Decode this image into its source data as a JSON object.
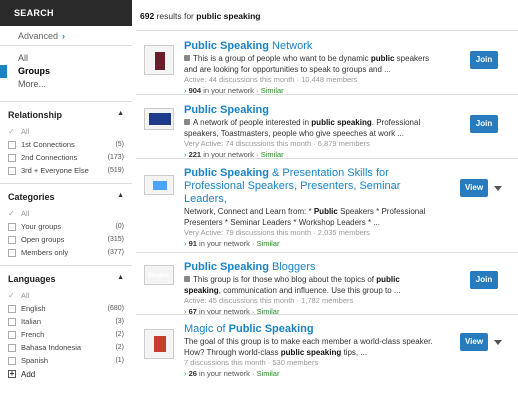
{
  "sidebar": {
    "search_label": "SEARCH",
    "advanced_label": "Advanced",
    "types": [
      {
        "label": "All",
        "active": false
      },
      {
        "label": "Groups",
        "active": true
      },
      {
        "label": "More...",
        "active": false
      }
    ],
    "facets": [
      {
        "title": "Relationship",
        "rows": [
          {
            "label": "All",
            "count": "",
            "checked": true
          },
          {
            "label": "1st Connections",
            "count": "(5)",
            "checked": false
          },
          {
            "label": "2nd Connections",
            "count": "(173)",
            "checked": false
          },
          {
            "label": "3rd + Everyone Else",
            "count": "(519)",
            "checked": false
          }
        ]
      },
      {
        "title": "Categories",
        "rows": [
          {
            "label": "All",
            "count": "",
            "checked": true
          },
          {
            "label": "Your groups",
            "count": "(0)",
            "checked": false
          },
          {
            "label": "Open groups",
            "count": "(315)",
            "checked": false
          },
          {
            "label": "Members only",
            "count": "(377)",
            "checked": false
          }
        ]
      },
      {
        "title": "Languages",
        "rows": [
          {
            "label": "All",
            "count": "",
            "checked": true
          },
          {
            "label": "English",
            "count": "(680)",
            "checked": false
          },
          {
            "label": "Italian",
            "count": "(3)",
            "checked": false
          },
          {
            "label": "French",
            "count": "(2)",
            "checked": false
          },
          {
            "label": "Bahasa Indonesia",
            "count": "(2)",
            "checked": false
          },
          {
            "label": "Spanish",
            "count": "(1)",
            "checked": false
          }
        ],
        "add_label": "Add"
      }
    ]
  },
  "results": {
    "count": "692",
    "results_for": "results for",
    "query": "public speaking",
    "items": [
      {
        "title_bold": "Public Speaking",
        "title_rest": " Network",
        "desc_parts": [
          "This is a group of people who want to be dynamic ",
          "public",
          " speakers and are looking for opportunities to speak to groups and ..."
        ],
        "stats": "Active: 44 discussions this month · 10,448 members",
        "network_count": "904",
        "network_label": "in your network",
        "similar": "Similar",
        "action": "Join",
        "lock": true
      },
      {
        "title_bold": "Public Speaking",
        "title_rest": "",
        "desc_parts": [
          "A network of people interested in ",
          "public speaking",
          ". Professional speakers, Toastmasters, people who give speeches at work ..."
        ],
        "stats": "Very Active: 74 discussions this month · 6,879 members",
        "network_count": "221",
        "network_label": "in your network",
        "similar": "Similar",
        "action": "Join",
        "lock": true
      },
      {
        "title_bold": "Public Speaking",
        "title_rest": " & Presentation Skills for Professional Speakers, Presenters, Seminar Leaders,",
        "desc_parts": [
          "Network, Connect and Learn from: * ",
          "Public",
          " Speakers * Professional Presenters * Seminar Leaders * Workshop Leaders * ..."
        ],
        "stats": "Very Active: 79 discussions this month · 2,035 members",
        "network_count": "91",
        "network_label": "in your network",
        "similar": "Similar",
        "action": "View",
        "lock": false
      },
      {
        "title_bold": "Public Speaking",
        "title_rest": " Bloggers",
        "desc_parts": [
          "This group is for those who blog about the topics of ",
          "public speaking",
          ", communication and influence. Use this group to ..."
        ],
        "stats": "Active: 45 discussions this month · 1,782 members",
        "network_count": "67",
        "network_label": "in your network",
        "similar": "Similar",
        "action": "Join",
        "lock": true,
        "thumb_text": "Blogito, ergo sum"
      },
      {
        "title_bold": "Public Speaking",
        "title_pre": "Magic of ",
        "title_rest": "",
        "desc_parts": [
          "The goal of this group is to make each member a world-class speaker. How? Through world-class ",
          "public speaking",
          " tips, ..."
        ],
        "stats": "7 discussions this month · 530 members",
        "network_count": "26",
        "network_label": "in your network",
        "similar": "Similar",
        "action": "View",
        "lock": false
      }
    ]
  }
}
